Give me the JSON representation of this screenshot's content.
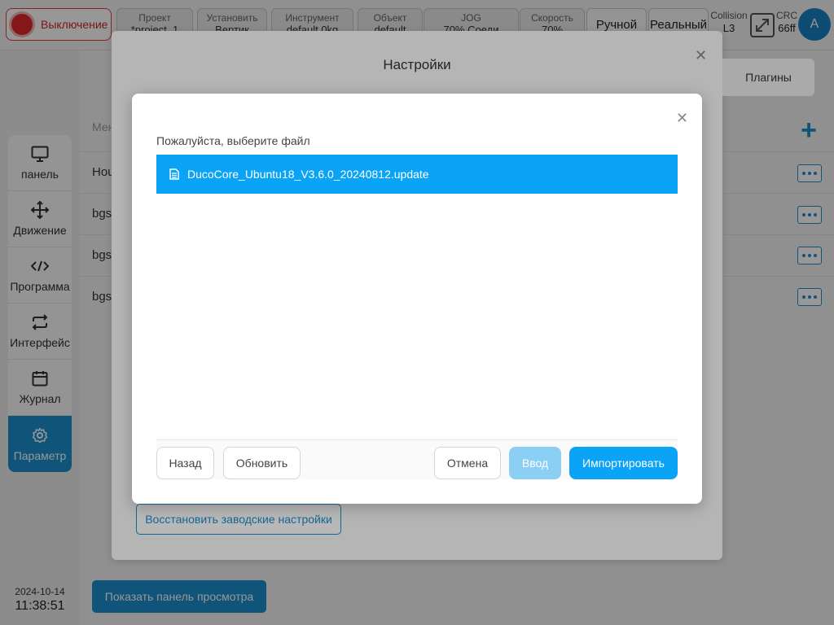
{
  "topbar": {
    "power_label": "Выключение",
    "project": {
      "label": "Проект",
      "value": "*project_1"
    },
    "setup": {
      "label": "Установить",
      "value": "Вертик"
    },
    "tool": {
      "label": "Инструмент",
      "value": "default    0kg"
    },
    "object": {
      "label": "Объект",
      "value": "default"
    },
    "jog": {
      "label": "JOG",
      "value": "70%    Соеди"
    },
    "speed": {
      "label": "Скорость",
      "value": "70%"
    },
    "mode_label": "Ручной",
    "real_label": "Реальный",
    "collision": {
      "label": "Collision",
      "value": "L3"
    },
    "crc": {
      "label": "CRC",
      "value": "66ff"
    },
    "avatar": "A"
  },
  "sidebar": {
    "items": [
      {
        "label": "панель",
        "icon": "monitor-icon"
      },
      {
        "label": "Движение",
        "icon": "move-icon"
      },
      {
        "label": "Программа",
        "icon": "code-icon"
      },
      {
        "label": "Интерфейс",
        "icon": "swap-icon"
      },
      {
        "label": "Журнал",
        "icon": "calendar-icon"
      },
      {
        "label": "Параметр",
        "icon": "gear-icon",
        "active": true
      }
    ]
  },
  "datetime": {
    "date": "2024-10-14",
    "time": "11:38:51"
  },
  "background": {
    "column_header": "Мен",
    "rows": [
      "Hou",
      "bgs",
      "bgs",
      "bgs"
    ],
    "show_panel_label": "Показать панель просмотра"
  },
  "settings": {
    "title": "Настройки",
    "tab_plugins": "Плагины",
    "restore_label": "Восстановить заводские настройки"
  },
  "file_dialog": {
    "prompt": "Пожалуйста, выберите файл",
    "files": [
      "DucoCore_Ubuntu18_V3.6.0_20240812.update"
    ],
    "back_label": "Назад",
    "refresh_label": "Обновить",
    "cancel_label": "Отмена",
    "enter_label": "Ввод",
    "import_label": "Импортировать"
  },
  "colors": {
    "accent": "#0aa3f5",
    "sidebar_active": "#1d8fd0",
    "power": "#e02a2a"
  }
}
